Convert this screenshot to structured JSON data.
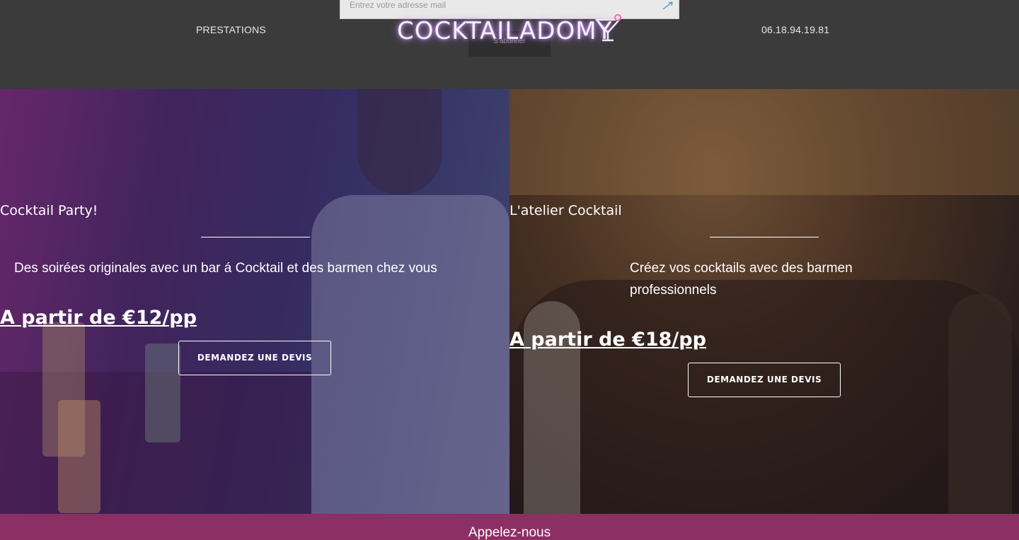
{
  "header": {
    "nav_prestations": "PRESTATIONS",
    "phone": "06.18.94.19.81",
    "logo_text": "COCKTAILADOMY",
    "newsletter": {
      "placeholder": "Entrez votre adresse mail",
      "subscribe_label": "S'abonner"
    }
  },
  "panels": [
    {
      "title": "Cocktail Party!",
      "description": "Des soirées originales avec un bar á Cocktail et des barmen chez vous",
      "price": "A partir de €12/pp",
      "button": "DEMANDEZ UNE DEVIS"
    },
    {
      "title": "L'atelier Cocktail",
      "description": "Créez vos cocktails avec des barmen professionnels",
      "price": "A partir de €18/pp",
      "button": "DEMANDEZ UNE DEVIS"
    }
  ],
  "call_bar": {
    "label": "Appelez-nous"
  },
  "colors": {
    "header_bg": "#3b3b3b",
    "call_bar_bg": "#8c2f64",
    "logo_glow": "#d7a3ff"
  }
}
